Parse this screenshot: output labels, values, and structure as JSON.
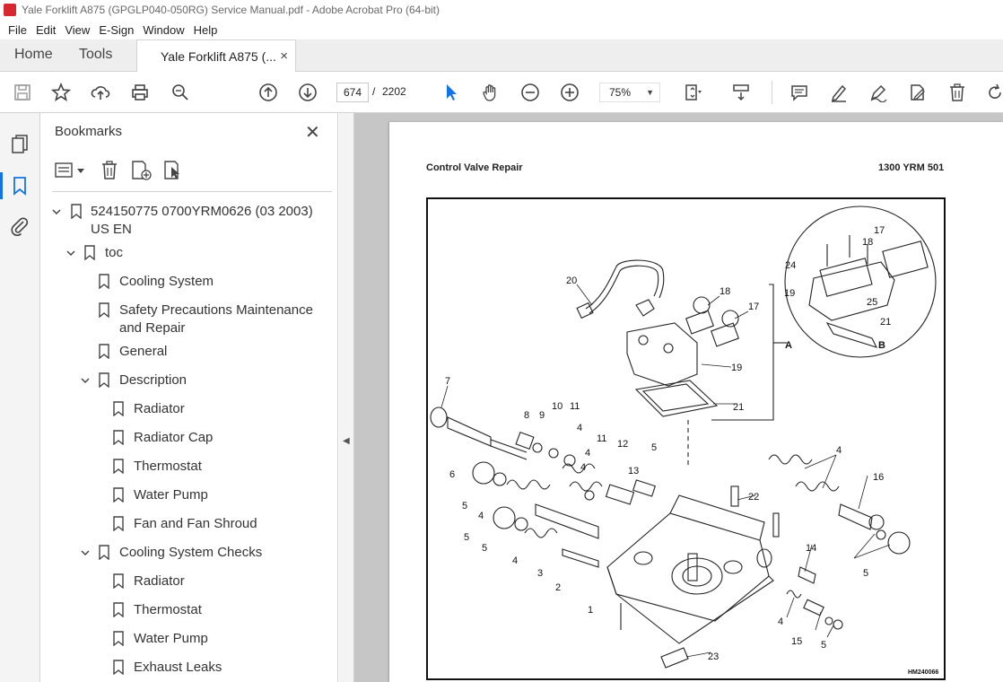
{
  "window": {
    "title": "Yale Forklift A875 (GPGLP040-050RG) Service Manual.pdf - Adobe Acrobat Pro (64-bit)"
  },
  "menu": [
    "File",
    "Edit",
    "View",
    "E-Sign",
    "Window",
    "Help"
  ],
  "tabs": {
    "home": "Home",
    "tools": "Tools",
    "document": "Yale Forklift A875 (...",
    "close": "×"
  },
  "toolbar": {
    "page_current": "674",
    "page_sep": "/",
    "page_total": "2202",
    "zoom": "75%"
  },
  "bookmarks": {
    "title": "Bookmarks",
    "items": [
      {
        "label": "524150775 0700YRM0626 (03 2003)",
        "label2": "US EN",
        "level": 0,
        "expanded": true
      },
      {
        "label": "toc",
        "level": 1,
        "expanded": true
      },
      {
        "label": "Cooling System",
        "level": 2
      },
      {
        "label": "Safety Precautions Maintenance",
        "label2": "and Repair",
        "level": 2
      },
      {
        "label": "General",
        "level": 2
      },
      {
        "label": "Description",
        "level": 2,
        "expanded": true
      },
      {
        "label": "Radiator",
        "level": 3
      },
      {
        "label": "Radiator Cap",
        "level": 3
      },
      {
        "label": "Thermostat",
        "level": 3
      },
      {
        "label": "Water Pump",
        "level": 3
      },
      {
        "label": "Fan and Fan Shroud",
        "level": 3
      },
      {
        "label": "Cooling System Checks",
        "level": 2,
        "expanded": true
      },
      {
        "label": "Radiator",
        "level": 3
      },
      {
        "label": "Thermostat",
        "level": 3
      },
      {
        "label": "Water Pump",
        "level": 3
      },
      {
        "label": "Exhaust Leaks",
        "level": 3
      }
    ]
  },
  "document": {
    "header_left": "Control Valve Repair",
    "header_right": "1300 YRM 501",
    "figure_id": "HM240066",
    "callouts": [
      "20",
      "18",
      "17",
      "19",
      "21",
      "7",
      "8",
      "9",
      "10",
      "11",
      "4",
      "6",
      "5",
      "4",
      "12",
      "13",
      "11",
      "4",
      "5",
      "3",
      "2",
      "1",
      "22",
      "14",
      "15",
      "16",
      "23",
      "A",
      "24",
      "18",
      "17",
      "19",
      "25",
      "21",
      "B",
      "4",
      "4",
      "5",
      "5",
      "4",
      "5",
      "4",
      "5"
    ]
  }
}
